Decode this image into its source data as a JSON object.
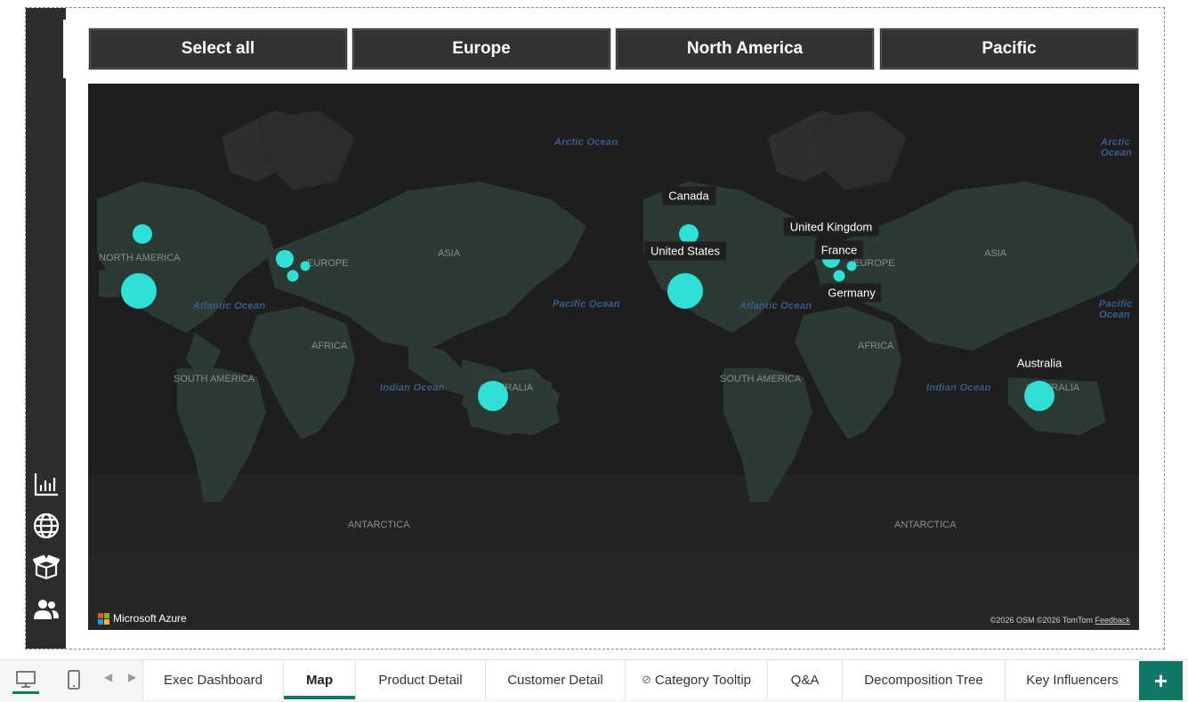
{
  "slicers": {
    "select_all": "Select all",
    "europe": "Europe",
    "north_america": "North America",
    "pacific": "Pacific"
  },
  "map": {
    "oceans": {
      "arctic_1": "Arctic Ocean",
      "arctic_2": "Arctic Ocean",
      "atlantic_1": "Atlantic Ocean",
      "atlantic_2": "Atlantic Ocean",
      "pacific_1": "Pacific Ocean",
      "pacific_2": "Pacific Ocean",
      "indian_1": "Indian Ocean",
      "indian_2": "Indian Ocean"
    },
    "continents": {
      "north_america": "NORTH AMERICA",
      "europe_1": "EUROPE",
      "europe_2": "EUROPE",
      "asia_1": "ASIA",
      "asia_2": "ASIA",
      "africa_1": "AFRICA",
      "africa_2": "AFRICA",
      "south_america_1": "SOUTH AMERICA",
      "south_america_2": "SOUTH AMERICA",
      "australia_1": "AUSTRALIA",
      "australia_2": "AUSTRALIA",
      "antarctica_1": "ANTARCTICA",
      "antarctica_2": "ANTARCTICA"
    },
    "country_labels": {
      "canada": "Canada",
      "united_states": "United States",
      "united_kingdom": "United Kingdom",
      "france": "France",
      "germany": "Germany",
      "australia": "Australia"
    },
    "bubble_color": "#2ee0d6",
    "provider": "Microsoft Azure",
    "attribution": "©2026 OSM  ©2026 TomTom",
    "feedback": "Feedback"
  },
  "tabs": {
    "exec_dashboard": "Exec Dashboard",
    "map": "Map",
    "product_detail": "Product Detail",
    "customer_detail": "Customer Detail",
    "category_tooltip": "Category Tooltip",
    "qa": "Q&A",
    "decomposition_tree": "Decomposition Tree",
    "key_influencers": "Key Influencers",
    "add": "+"
  },
  "colors": {
    "accent": "#117865",
    "rail": "#2d2d2d",
    "slicer": "#333333",
    "map_bg": "#1e1e1f",
    "land": "#2b3a33"
  },
  "icons": {
    "rail": [
      "bar-chart-icon",
      "globe-icon",
      "box-icon",
      "people-icon"
    ],
    "view": [
      "desktop-icon",
      "phone-icon"
    ]
  }
}
